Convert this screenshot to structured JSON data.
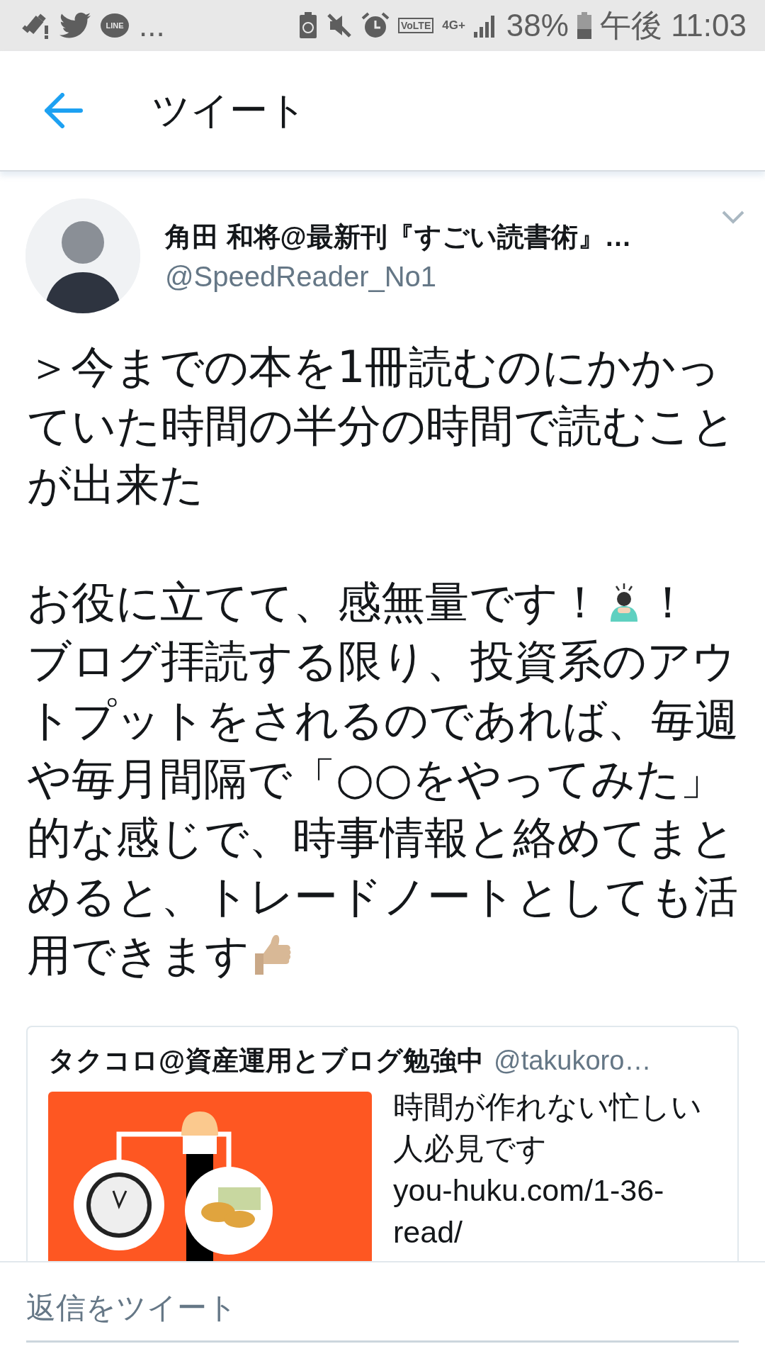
{
  "status_bar": {
    "more": "...",
    "app_label": "LINE",
    "network_label": "VoLTE",
    "data_label": "4G+",
    "battery": "38%",
    "time": "午後 11:03"
  },
  "header": {
    "title": "ツイート"
  },
  "tweet": {
    "author_name": "角田 和将@最新刊『すごい読書術』…",
    "handle": "@SpeedReader_No1",
    "paragraphs": [
      [
        [
          {
            "kind": "text",
            "text": "＞今までの本を1冊読むのにかかっていた時間の半分の時間で読むことが出来た"
          }
        ]
      ],
      [
        [
          {
            "kind": "text",
            "text": "お役に立てて、感無量です！"
          },
          {
            "kind": "bowing"
          },
          {
            "kind": "text",
            "text": "！"
          }
        ],
        [
          {
            "kind": "text",
            "text": "ブログ拝読する限り、投資系のアウトプットをされるのであれば、毎週や毎月間隔で「○○をやってみた」的な感じで、時事情報と絡めてまとめると、トレードノートとしても活"
          }
        ],
        [
          {
            "kind": "text",
            "text": "用できます"
          },
          {
            "kind": "thumbs"
          }
        ]
      ]
    ]
  },
  "quote": {
    "author_name": "タクコロ@資産運用とブログ勉強中",
    "handle": "@takukoro…",
    "title": "時間が作れない忙しい人必見です",
    "url": "you-huku.com/1-36-read/"
  },
  "reply": {
    "placeholder": "返信をツイート"
  }
}
